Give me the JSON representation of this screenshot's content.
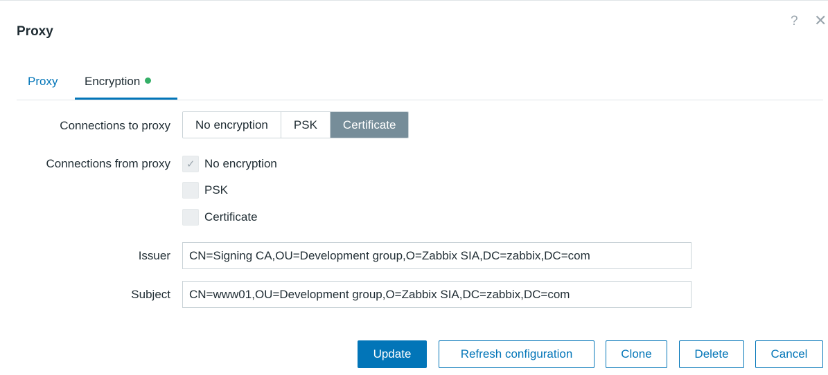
{
  "dialog": {
    "title": "Proxy",
    "help_glyph": "?",
    "close_glyph": "✕"
  },
  "tabs": [
    {
      "label": "Proxy"
    },
    {
      "label": "Encryption"
    }
  ],
  "form": {
    "connections_to_label": "Connections to proxy",
    "connections_to_options": [
      "No encryption",
      "PSK",
      "Certificate"
    ],
    "connections_to_selected": "Certificate",
    "connections_from_label": "Connections from proxy",
    "connections_from_options": [
      {
        "label": "No encryption",
        "checked": true
      },
      {
        "label": "PSK",
        "checked": false
      },
      {
        "label": "Certificate",
        "checked": false
      }
    ],
    "issuer_label": "Issuer",
    "issuer_value": "CN=Signing CA,OU=Development group,O=Zabbix SIA,DC=zabbix,DC=com",
    "subject_label": "Subject",
    "subject_value": "CN=www01,OU=Development group,O=Zabbix SIA,DC=zabbix,DC=com"
  },
  "footer": {
    "update": "Update",
    "refresh": "Refresh configuration",
    "clone": "Clone",
    "delete": "Delete",
    "cancel": "Cancel"
  },
  "colors": {
    "accent": "#0275b8",
    "segment_active": "#768d99",
    "status_dot": "#34af67"
  }
}
